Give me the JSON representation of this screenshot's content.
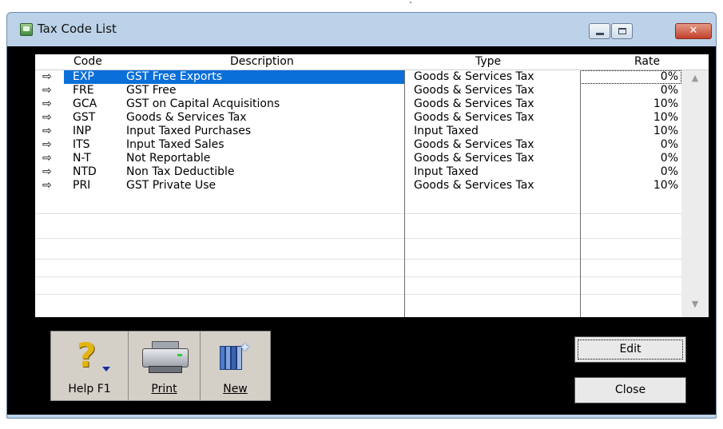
{
  "window": {
    "title": "Tax Code List"
  },
  "titlebar": {
    "minimize_glyph": "–",
    "maximize_glyph": "□",
    "close_glyph": "✕"
  },
  "columns": {
    "code": "Code",
    "description": "Description",
    "type": "Type",
    "rate": "Rate"
  },
  "row_marker": "⇨",
  "rows": [
    {
      "code": "EXP",
      "description": "GST Free Exports",
      "type": "Goods & Services Tax",
      "rate": "0%",
      "selected": true
    },
    {
      "code": "FRE",
      "description": "GST Free",
      "type": "Goods & Services Tax",
      "rate": "0%"
    },
    {
      "code": "GCA",
      "description": "GST on Capital Acquisitions",
      "type": "Goods & Services Tax",
      "rate": "10%"
    },
    {
      "code": "GST",
      "description": "Goods & Services Tax",
      "type": "Goods & Services Tax",
      "rate": "10%"
    },
    {
      "code": "INP",
      "description": "Input Taxed Purchases",
      "type": "Input Taxed",
      "rate": "10%"
    },
    {
      "code": "ITS",
      "description": "Input Taxed Sales",
      "type": "Goods & Services Tax",
      "rate": "0%"
    },
    {
      "code": "N-T",
      "description": "Not Reportable",
      "type": "Goods & Services Tax",
      "rate": "0%"
    },
    {
      "code": "NTD",
      "description": "Non Tax Deductible",
      "type": "Input Taxed",
      "rate": "0%"
    },
    {
      "code": "PRI",
      "description": "GST Private Use",
      "type": "Goods & Services Tax",
      "rate": "10%"
    }
  ],
  "toolbar": {
    "help_label": "Help F1",
    "help_icon": "?",
    "print_label": "Print",
    "new_label": "New"
  },
  "buttons": {
    "edit": "Edit",
    "close": "Close"
  },
  "scroll": {
    "up": "▲",
    "down": "▼"
  },
  "colors": {
    "selection": "#0a6fd8",
    "client_background": "#000000",
    "window_frame": "#bcd2e8"
  }
}
